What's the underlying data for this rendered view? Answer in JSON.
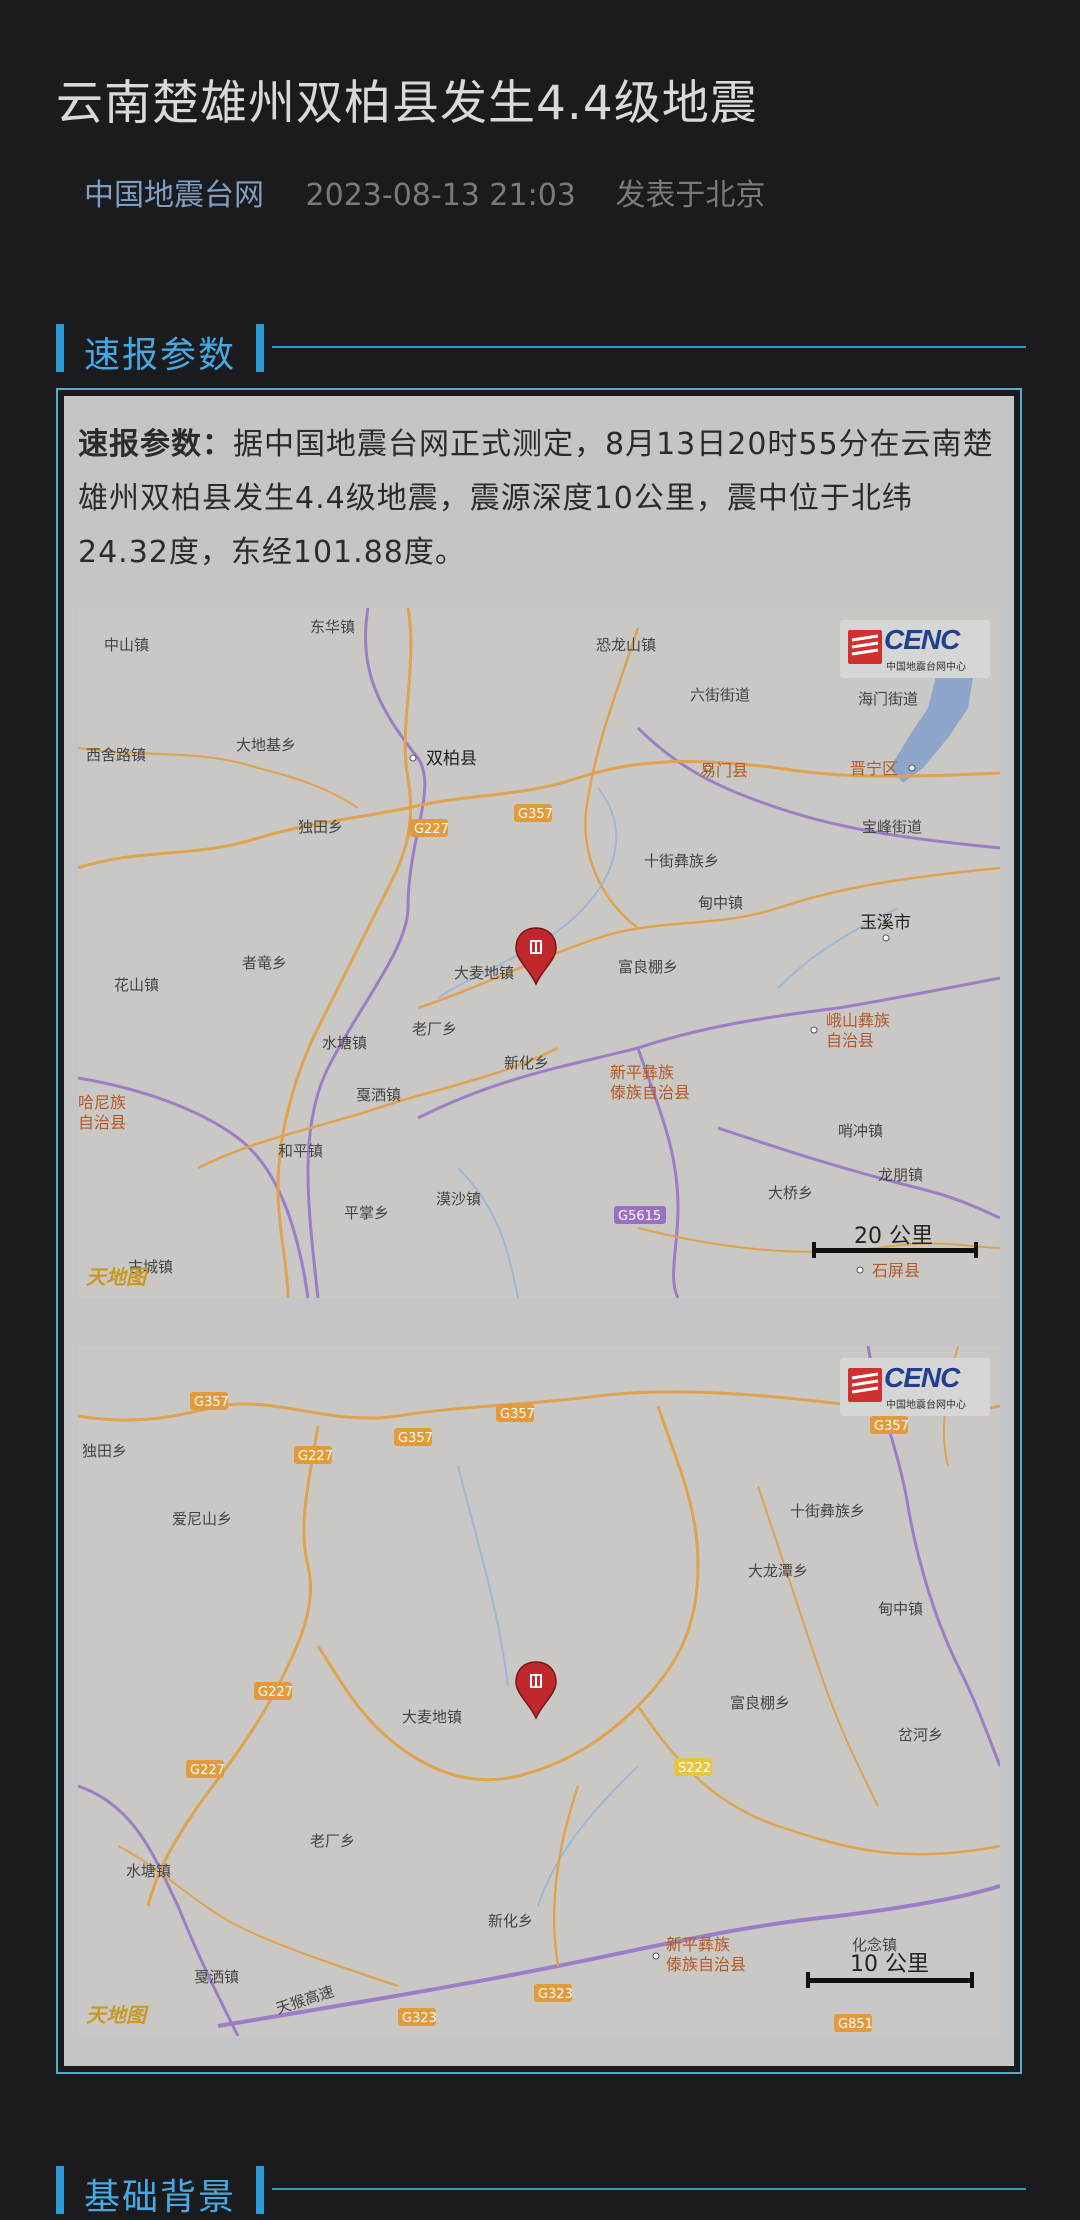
{
  "article": {
    "title": "云南楚雄州双柏县发生4.4级地震",
    "source": "中国地震台网",
    "datetime": "2023-08-13 21:03",
    "location": "发表于北京"
  },
  "section1": {
    "heading": "速报参数",
    "lead": "速报参数：",
    "body": "据中国地震台网正式测定，8月13日20时55分在云南楚雄州双柏县发生4.4级地震，震源深度10公里，震中位于北纬24.32度，东经101.88度。"
  },
  "map1": {
    "brand": "CENC",
    "brand_sub": "中国地震台网中心",
    "scale": "20 公里",
    "watermark": "天地图",
    "places": {
      "zhongshan": "中山镇",
      "donghua": "东华镇",
      "konglongshan": "恐龙山镇",
      "liujie": "六街街道",
      "haimen": "海门街道",
      "xisheroad": "西舍路镇",
      "dadiji": "大地基乡",
      "shuangbai": "双柏县",
      "eshan": "易门县",
      "jinning": "晋宁区",
      "dutian": "独田乡",
      "shijie": "十街彝族乡",
      "baofeng": "宝峰街道",
      "dianzhong": "甸中镇",
      "yuxi": "玉溪市",
      "zhelong": "者竜乡",
      "huashan": "花山镇",
      "damaidi": "大麦地镇",
      "fuliangpeng": "富良棚乡",
      "laochang": "老厂乡",
      "shuitang": "水塘镇",
      "eshan2": "峨山彝族",
      "eshan3": "自治县",
      "xinhua": "新化乡",
      "xinping1": "新平彝族",
      "xinping2": "傣族自治县",
      "gasa": "戛洒镇",
      "hala1": "哈尼族",
      "hala2": "自治县",
      "heping": "和平镇",
      "xiaojie": "哨冲镇",
      "longpeng": "龙朋镇",
      "pingzhang": "平掌乡",
      "mosha": "漠沙镇",
      "daqiao": "大桥乡",
      "shiping": "石屏县",
      "gucheng": "古城镇"
    },
    "roads": {
      "g227": "G227",
      "g357": "G357",
      "g5615": "G5615"
    }
  },
  "map2": {
    "brand": "CENC",
    "brand_sub": "中国地震台网中心",
    "scale": "10 公里",
    "watermark": "天地图",
    "places": {
      "dutian": "独田乡",
      "ainishan": "爱尼山乡",
      "shijie": "十街彝族乡",
      "dalongtan": "大龙潭乡",
      "dianzhong": "甸中镇",
      "damaidi": "大麦地镇",
      "fuliangpeng": "富良棚乡",
      "yahe": "岔河乡",
      "laochang": "老厂乡",
      "shuitang": "水塘镇",
      "xinhua": "新化乡",
      "xinping1": "新平彝族",
      "xinping2": "傣族自治县",
      "huanian": "化念镇",
      "gasa": "戛洒镇",
      "tianhou": "天猴高速"
    },
    "roads": {
      "g357": "G357",
      "g227": "G227",
      "s222": "S222",
      "g323": "G323",
      "g851": "G851"
    }
  },
  "section2": {
    "heading": "基础背景"
  },
  "colors": {
    "accent": "#2f9bd6",
    "panel_border": "#4fb0c8",
    "source_link": "#7f9ec3",
    "pin": "#c0282d"
  }
}
